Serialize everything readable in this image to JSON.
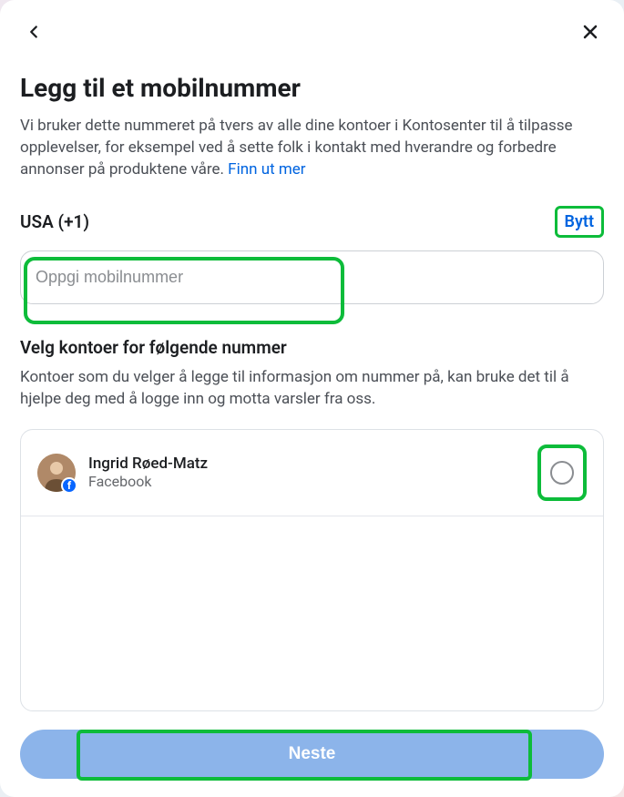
{
  "header": {
    "title": "Legg til et mobilnummer",
    "description": "Vi bruker dette nummeret på tvers av alle dine kontoer i Kontosenter til å tilpasse opplevelser, for eksempel ved å sette folk i kontakt med hverandre og forbedre annonser på produktene våre. ",
    "learn_more": "Finn ut mer"
  },
  "country": {
    "label": "USA (+1)",
    "change": "Bytt"
  },
  "phone": {
    "placeholder": "Oppgi mobilnummer",
    "value": ""
  },
  "accounts_section": {
    "title": "Velg kontoer for følgende nummer",
    "description": "Kontoer som du velger å legge til informasjon om nummer på, kan bruke det til å hjelpe deg med å logge inn og motta varsler fra oss."
  },
  "accounts": [
    {
      "name": "Ingrid Røed-Matz",
      "platform": "Facebook"
    }
  ],
  "next_button": "Neste"
}
